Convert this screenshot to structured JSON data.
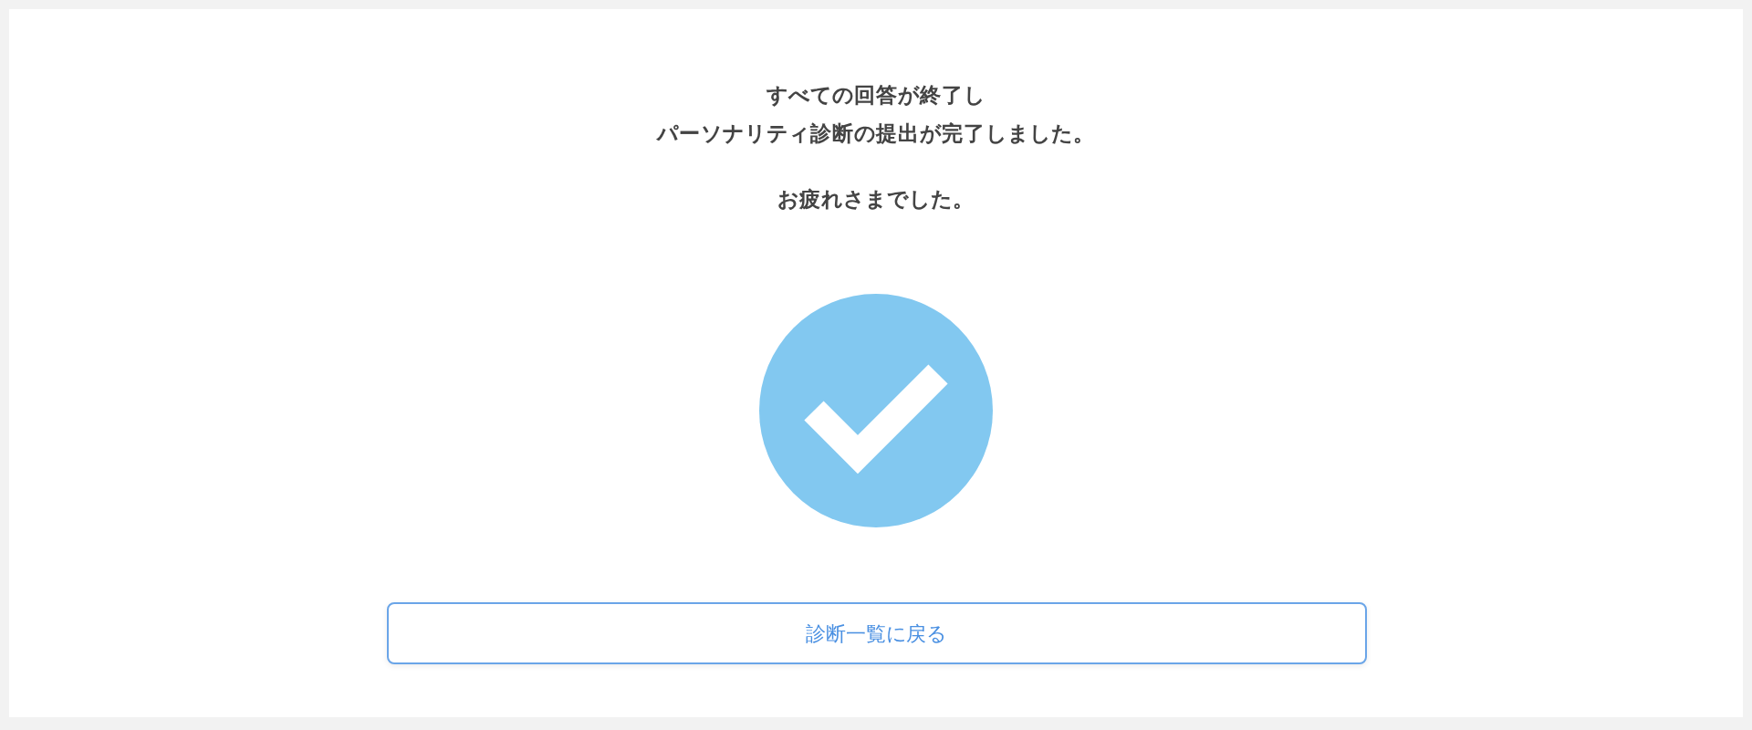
{
  "message_lines": [
    "すべての回答が終了し",
    "パーソナリティ診断の提出が完了しました。"
  ],
  "closing": "お疲れさまでした。",
  "button": {
    "label": "診断一覧に戻る"
  }
}
